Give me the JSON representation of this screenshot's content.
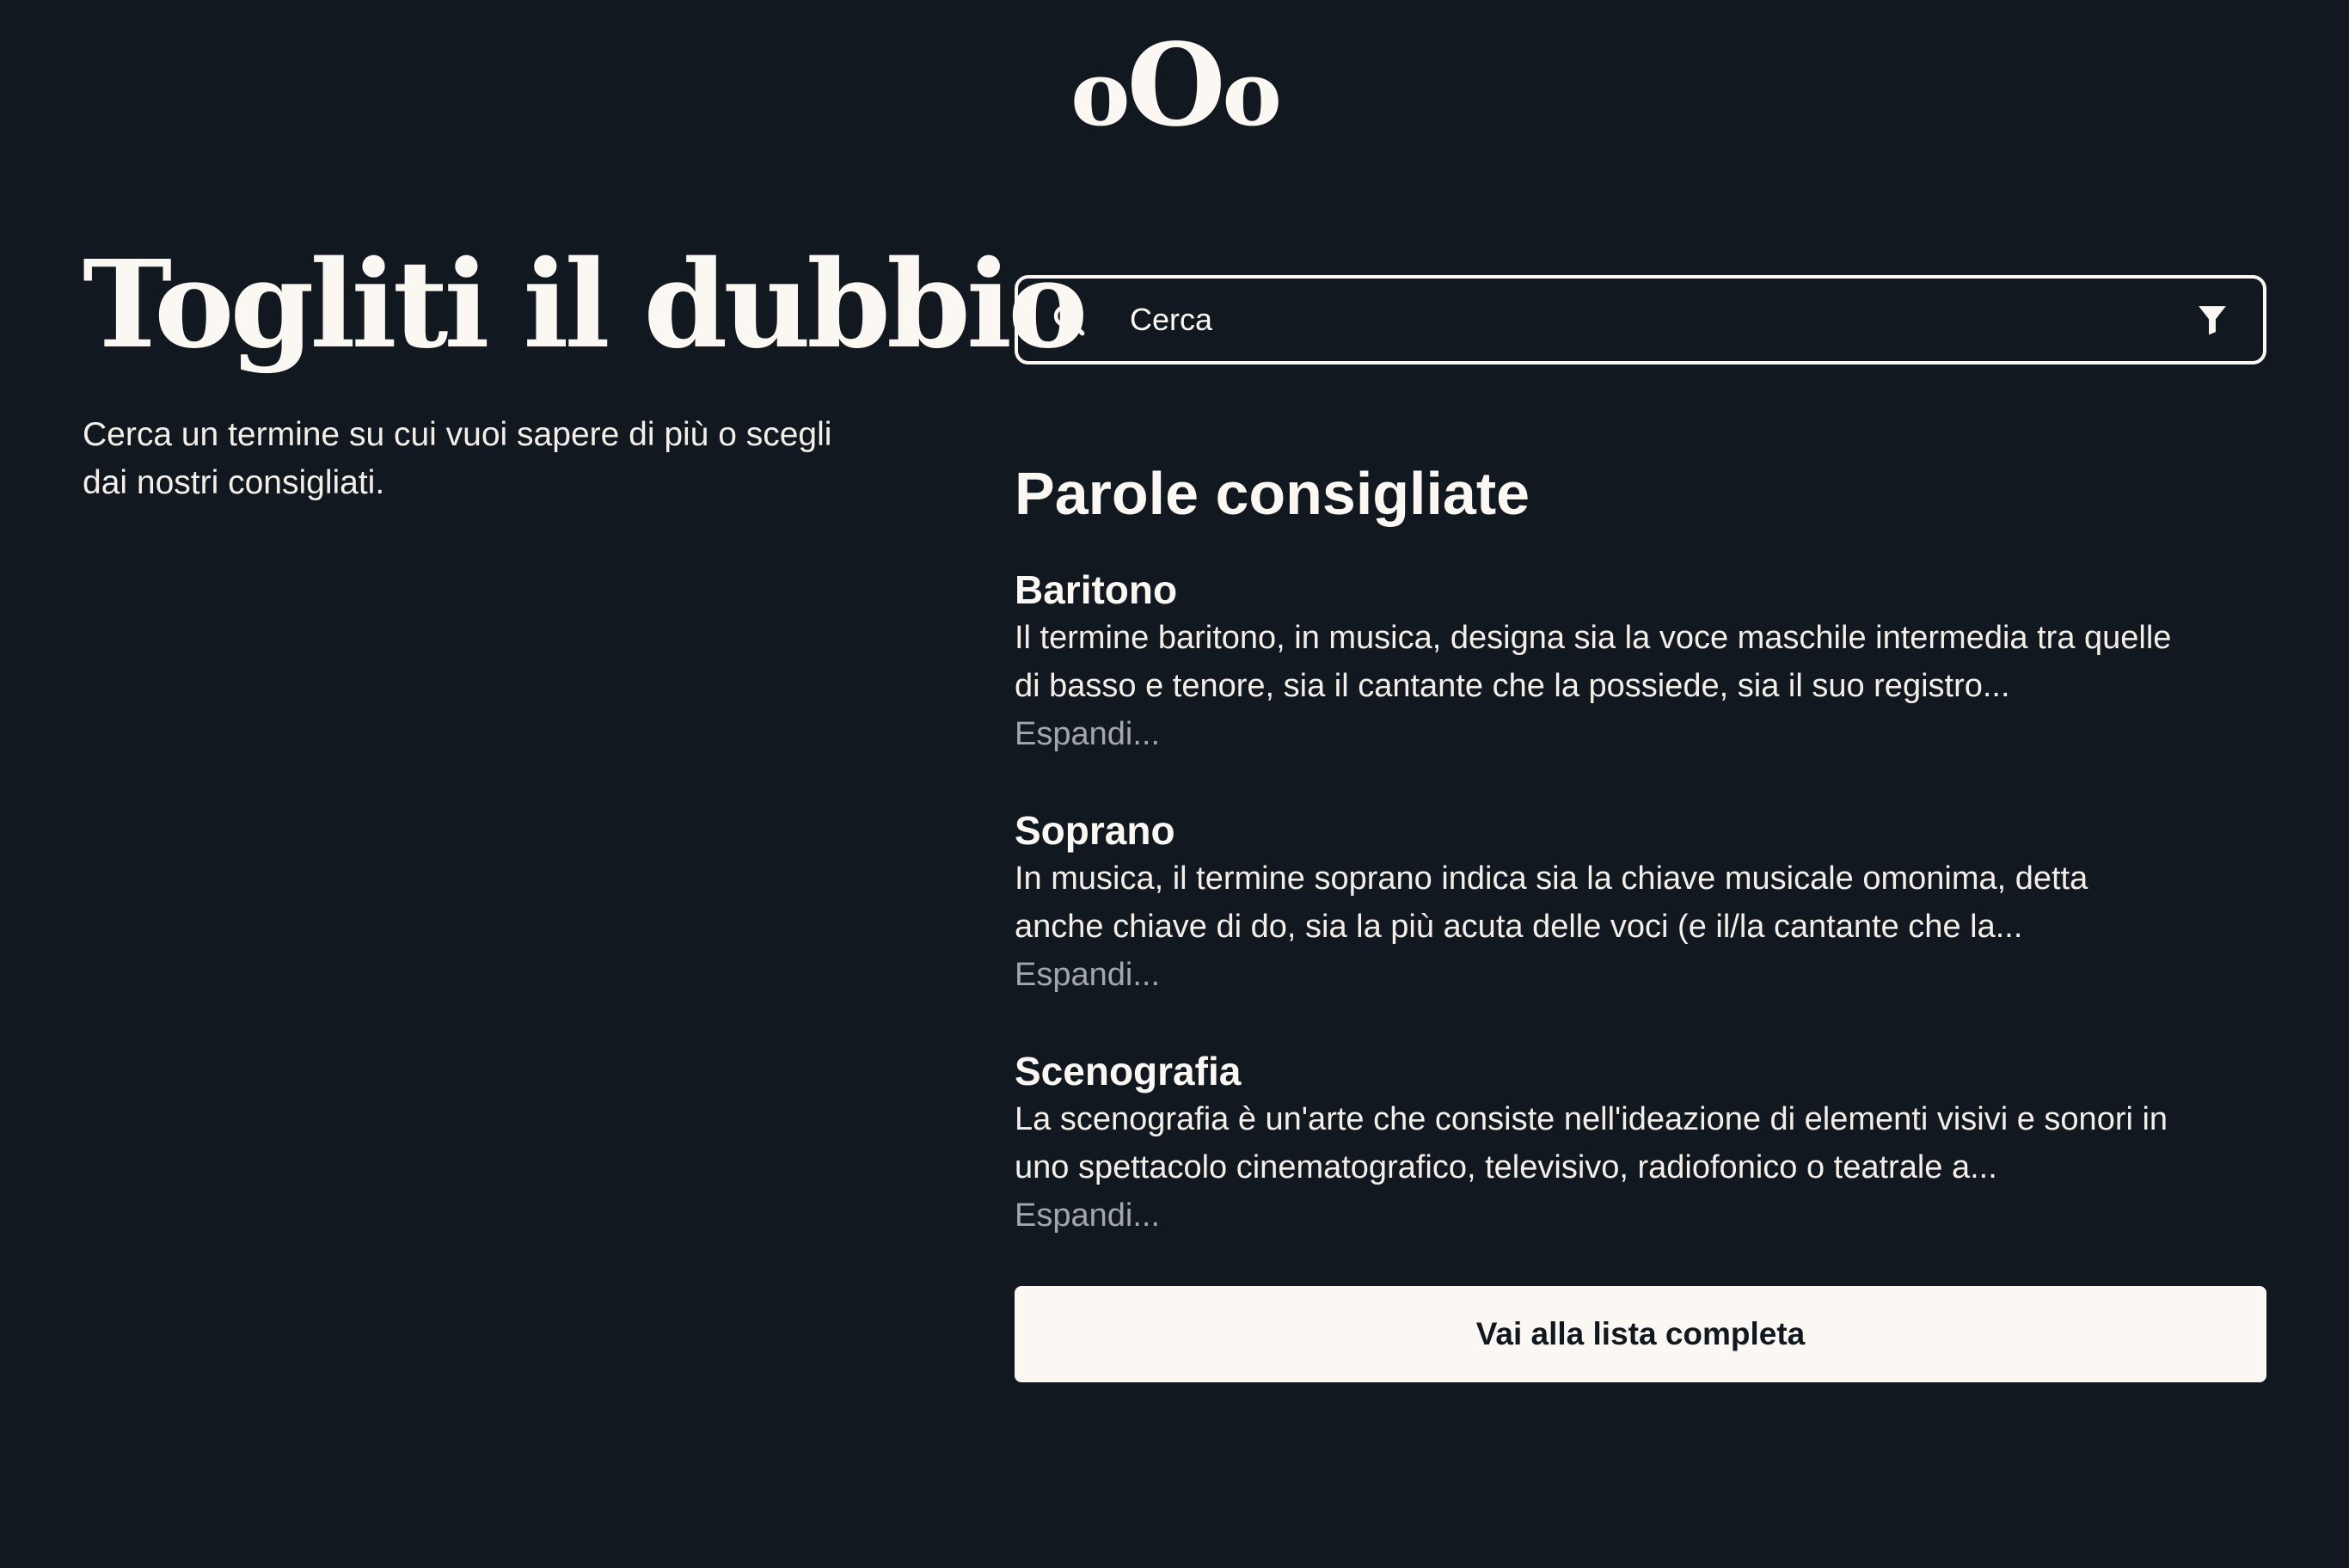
{
  "logo": {
    "left": "o",
    "middle": "O",
    "right": "o"
  },
  "hero": {
    "title": "Togliti il dubbio",
    "description": "Cerca un termine su cui vuoi sapere di più o scegli dai nostri consigliati."
  },
  "search": {
    "placeholder": "Cerca",
    "value": "",
    "search_icon": "search-icon",
    "filter_icon": "filter-icon"
  },
  "recommended": {
    "title": "Parole consigliate",
    "items": [
      {
        "term": "Baritono",
        "excerpt": "Il termine baritono, in musica, designa sia la voce maschile intermedia tra quelle di basso e tenore, sia il cantante che la possiede, sia il suo registro...",
        "expand_label": "Espandi..."
      },
      {
        "term": "Soprano",
        "excerpt": "In musica, il termine soprano indica sia la chiave musicale omonima, detta anche chiave di do, sia la più acuta delle voci (e il/la cantante che la...",
        "expand_label": "Espandi..."
      },
      {
        "term": "Scenografia",
        "excerpt": "La scenografia è un'arte che consiste nell'ideazione di elementi visivi e sonori in uno spettacolo cinematografico, televisivo, radiofonico o teatrale a...",
        "expand_label": "Espandi..."
      }
    ],
    "full_list_label": "Vai alla lista completa"
  },
  "colors": {
    "background": "#121820",
    "text": "#fbf8f3",
    "muted": "#a3a7ab",
    "button_bg": "#fbf8f3",
    "button_text": "#121820"
  }
}
